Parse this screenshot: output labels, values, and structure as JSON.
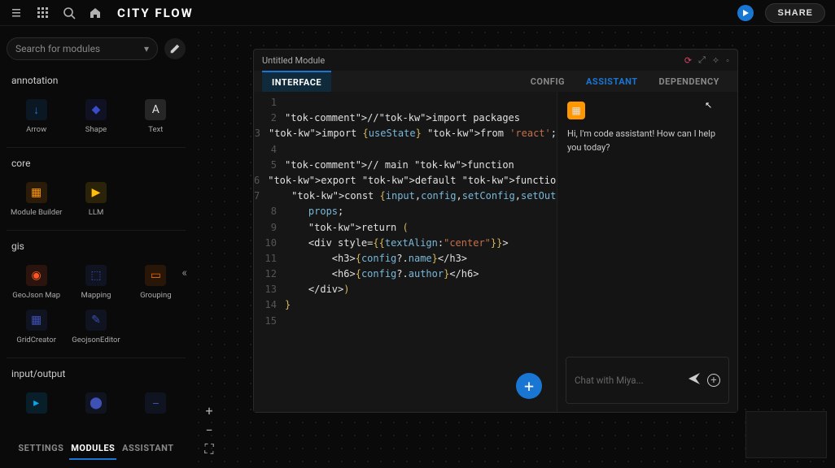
{
  "header": {
    "title": "CITY FLOW",
    "share_label": "SHARE"
  },
  "sidebar": {
    "search_placeholder": "Search for modules",
    "categories": [
      {
        "title": "annotation",
        "items": [
          {
            "label": "Arrow",
            "color": "#1976d2",
            "glyph": "↓"
          },
          {
            "label": "Shape",
            "color": "#3a4bc7",
            "glyph": "◆"
          },
          {
            "label": "Text",
            "color": "#e0e0e0",
            "glyph": "A"
          }
        ]
      },
      {
        "title": "core",
        "items": [
          {
            "label": "Module Builder",
            "color": "#ff9800",
            "glyph": "▦"
          },
          {
            "label": "LLM",
            "color": "#ffc107",
            "glyph": "▶"
          }
        ]
      },
      {
        "title": "gis",
        "items": [
          {
            "label": "GeoJson Map",
            "color": "#ff5722",
            "glyph": "◉"
          },
          {
            "label": "Mapping",
            "color": "#3f51b5",
            "glyph": "⬚"
          },
          {
            "label": "Grouping",
            "color": "#ef6c00",
            "glyph": "▭"
          },
          {
            "label": "GridCreator",
            "color": "#3f51b5",
            "glyph": "▦"
          },
          {
            "label": "GeojsonEditor",
            "color": "#3f51b5",
            "glyph": "✎"
          }
        ]
      },
      {
        "title": "input/output",
        "items": [
          {
            "label": "",
            "color": "#03a9f4",
            "glyph": "▸"
          },
          {
            "label": "",
            "color": "#3f51b5",
            "glyph": "⬤"
          },
          {
            "label": "",
            "color": "#3f51b5",
            "glyph": "⎯"
          }
        ]
      }
    ],
    "bottom_tabs": {
      "settings": "SETTINGS",
      "modules": "MODULES",
      "assistant": "ASSISTANT"
    }
  },
  "module": {
    "title": "Untitled Module",
    "left_tabs": {
      "interface": "INTERFACE"
    },
    "right_tabs": {
      "config": "CONFIG",
      "assistant": "ASSISTANT",
      "dependency": "DEPENDENCY"
    },
    "code": [
      "",
      "//import packages",
      "import {useState} from 'react';",
      "",
      "// main function",
      "export default function CustomUI(props){",
      "    const {input,config,setConfig,setOutput} =",
      "    props;",
      "    return (",
      "    <div style={{textAlign:\"center\"}}>",
      "        <h3>{config?.name}</h3>",
      "        <h6>{config?.author}</h6>",
      "    </div>)",
      "}",
      ""
    ]
  },
  "assistant": {
    "message": "Hi, I'm code assistant! How can I help you today?",
    "placeholder": "Chat with Miya..."
  }
}
